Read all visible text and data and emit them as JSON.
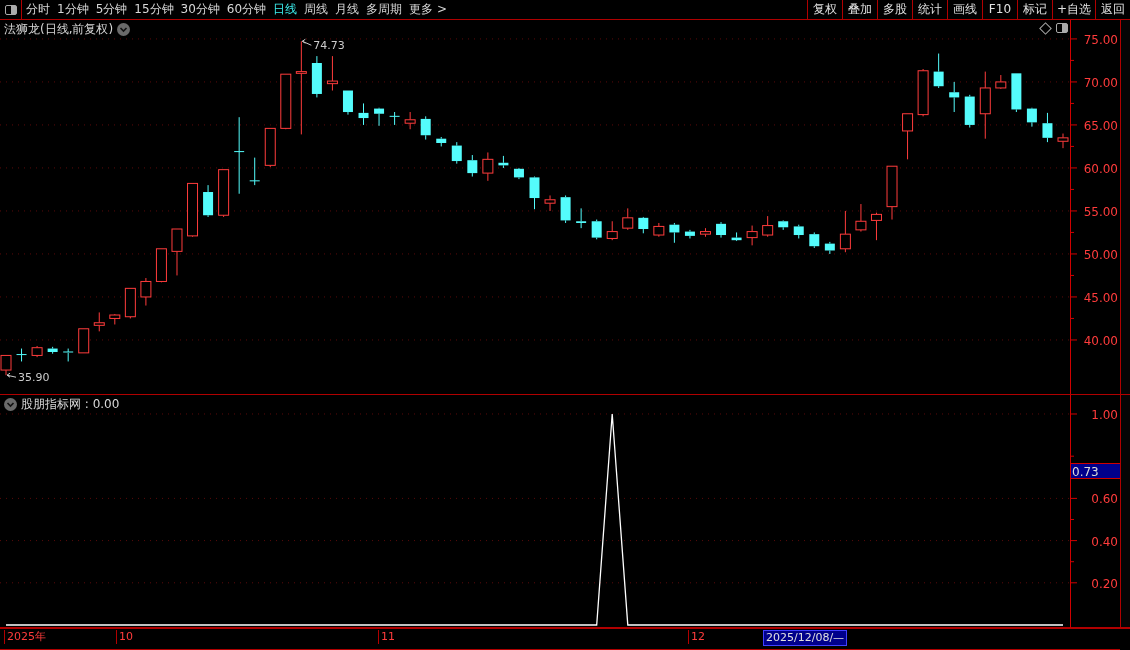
{
  "toolbar": {
    "periods": [
      {
        "label": "分时",
        "selected": false
      },
      {
        "label": "1分钟",
        "selected": false
      },
      {
        "label": "5分钟",
        "selected": false
      },
      {
        "label": "15分钟",
        "selected": false
      },
      {
        "label": "30分钟",
        "selected": false
      },
      {
        "label": "60分钟",
        "selected": false
      },
      {
        "label": "日线",
        "selected": true
      },
      {
        "label": "周线",
        "selected": false
      },
      {
        "label": "月线",
        "selected": false
      },
      {
        "label": "多周期",
        "selected": false
      },
      {
        "label": "更多 >",
        "selected": false
      }
    ],
    "buttons": [
      "复权",
      "叠加",
      "多股",
      "统计",
      "画线",
      "F10",
      "标记",
      "+自选",
      "返回"
    ]
  },
  "price_panel": {
    "title": "法狮龙(日线,前复权)",
    "high_label": "74.73",
    "low_label": "35.90",
    "chart_data": {
      "type": "candlestick",
      "ylim": [
        33.6,
        77.2
      ],
      "yticks": [
        {
          "value": 75,
          "label": "75.00"
        },
        {
          "value": 70,
          "label": "70.00"
        },
        {
          "value": 65,
          "label": "65.00"
        },
        {
          "value": 60,
          "label": "60.00"
        },
        {
          "value": 55,
          "label": "55.00"
        },
        {
          "value": 50,
          "label": "50.00"
        },
        {
          "value": 45,
          "label": "45.00"
        },
        {
          "value": 40,
          "label": "40.00"
        }
      ],
      "grid": true,
      "ohlc": [
        [
          36.5,
          38.2,
          35.9,
          38.2
        ],
        [
          38.3,
          39.0,
          37.5,
          38.3
        ],
        [
          38.2,
          39.3,
          38.0,
          39.1
        ],
        [
          39.0,
          39.2,
          38.4,
          38.6
        ],
        [
          38.6,
          39.0,
          37.5,
          38.5
        ],
        [
          38.5,
          41.3,
          38.5,
          41.3
        ],
        [
          41.7,
          43.2,
          41.0,
          42.0
        ],
        [
          42.5,
          43.0,
          41.8,
          42.9
        ],
        [
          42.7,
          46.0,
          42.5,
          46.0
        ],
        [
          45.0,
          47.2,
          44.0,
          46.8
        ],
        [
          46.8,
          50.6,
          46.7,
          50.6
        ],
        [
          50.3,
          52.9,
          47.5,
          52.9
        ],
        [
          52.1,
          58.2,
          52.0,
          58.2
        ],
        [
          57.2,
          58.0,
          54.3,
          54.5
        ],
        [
          54.5,
          59.8,
          54.3,
          59.8
        ],
        [
          61.9,
          65.9,
          57.0,
          61.9
        ],
        [
          58.5,
          61.2,
          58.0,
          58.5
        ],
        [
          60.3,
          64.6,
          60.1,
          64.6
        ],
        [
          64.6,
          70.9,
          64.5,
          70.9
        ],
        [
          71.0,
          74.73,
          63.9,
          71.2
        ],
        [
          72.2,
          73.0,
          68.2,
          68.6
        ],
        [
          69.8,
          73.0,
          69.0,
          70.1
        ],
        [
          69.0,
          69.0,
          66.2,
          66.5
        ],
        [
          66.4,
          67.5,
          65.0,
          65.8
        ],
        [
          66.9,
          67.0,
          64.9,
          66.3
        ],
        [
          66.0,
          66.5,
          65.0,
          66.0
        ],
        [
          65.2,
          66.5,
          64.5,
          65.6
        ],
        [
          65.7,
          66.0,
          63.3,
          63.8
        ],
        [
          63.4,
          63.6,
          62.5,
          62.9
        ],
        [
          62.6,
          63.0,
          60.5,
          60.8
        ],
        [
          60.9,
          61.5,
          59.0,
          59.4
        ],
        [
          59.4,
          61.8,
          58.5,
          61.0
        ],
        [
          60.6,
          61.4,
          60.0,
          60.3
        ],
        [
          59.9,
          60.0,
          58.7,
          58.9
        ],
        [
          58.9,
          59.0,
          55.2,
          56.5
        ],
        [
          55.9,
          56.8,
          55.0,
          56.3
        ],
        [
          56.6,
          56.8,
          53.6,
          53.9
        ],
        [
          53.8,
          55.3,
          53.0,
          53.6
        ],
        [
          53.8,
          54.0,
          51.7,
          51.9
        ],
        [
          51.8,
          53.8,
          51.6,
          52.6
        ],
        [
          53.0,
          55.3,
          52.8,
          54.2
        ],
        [
          54.2,
          54.3,
          52.4,
          52.9
        ],
        [
          52.2,
          53.6,
          52.0,
          53.2
        ],
        [
          53.4,
          53.6,
          51.3,
          52.5
        ],
        [
          52.6,
          52.8,
          51.8,
          52.1
        ],
        [
          52.3,
          53.0,
          52.0,
          52.6
        ],
        [
          53.5,
          53.7,
          51.9,
          52.2
        ],
        [
          51.9,
          52.5,
          51.5,
          51.6
        ],
        [
          51.9,
          53.3,
          51.0,
          52.6
        ],
        [
          52.2,
          54.4,
          52.0,
          53.3
        ],
        [
          53.8,
          53.9,
          52.8,
          53.1
        ],
        [
          53.2,
          53.4,
          51.8,
          52.2
        ],
        [
          52.3,
          52.5,
          50.7,
          50.9
        ],
        [
          51.2,
          51.4,
          50.0,
          50.4
        ],
        [
          50.6,
          55.0,
          50.2,
          52.3
        ],
        [
          52.8,
          55.8,
          52.6,
          53.8
        ],
        [
          53.9,
          54.8,
          51.6,
          54.6
        ],
        [
          55.5,
          60.2,
          54.0,
          60.2
        ],
        [
          64.3,
          66.3,
          61.0,
          66.3
        ],
        [
          66.2,
          71.5,
          66.0,
          71.3
        ],
        [
          71.2,
          73.3,
          69.3,
          69.5
        ],
        [
          68.8,
          70.0,
          66.5,
          68.2
        ],
        [
          68.3,
          68.5,
          64.7,
          65.0
        ],
        [
          66.3,
          71.2,
          63.4,
          69.3
        ],
        [
          69.3,
          70.8,
          69.2,
          70.0
        ],
        [
          71.0,
          71.0,
          66.5,
          66.8
        ],
        [
          66.9,
          67.0,
          64.8,
          65.3
        ],
        [
          65.2,
          66.4,
          63.0,
          63.5
        ],
        [
          63.1,
          64.0,
          62.3,
          63.5
        ]
      ]
    }
  },
  "indicator_panel": {
    "title": "股朋指标网 : 0.00",
    "cursor_value": "0.73",
    "chart_data": {
      "type": "line",
      "ylim": [
        0,
        1.09
      ],
      "grid": true,
      "yticks": [
        {
          "value": 1,
          "label": "1.00"
        },
        {
          "value": 0.6,
          "label": "0.60"
        },
        {
          "value": 0.4,
          "label": "0.40"
        },
        {
          "value": 0.2,
          "label": "0.20"
        }
      ],
      "series": [
        {
          "color": "#ffffff",
          "values": [
            0,
            0,
            0,
            0,
            0,
            0,
            0,
            0,
            0,
            0,
            0,
            0,
            0,
            0,
            0,
            0,
            0,
            0,
            0,
            0,
            0,
            0,
            0,
            0,
            0,
            0,
            0,
            0,
            0,
            0,
            0,
            0,
            0,
            0,
            0,
            0,
            0,
            0,
            0,
            1,
            0,
            0,
            0,
            0,
            0,
            0,
            0,
            0,
            0,
            0,
            0,
            0,
            0,
            0,
            0,
            0,
            0,
            0,
            0,
            0,
            0,
            0,
            0,
            0,
            0,
            0,
            0,
            0,
            0
          ]
        }
      ]
    }
  },
  "time_axis": {
    "labels": [
      {
        "label": "2025年",
        "selected": false
      },
      {
        "label": "10",
        "selected": false
      },
      {
        "label": "11",
        "selected": false
      },
      {
        "label": "12",
        "selected": false
      },
      {
        "label": "2025/12/08/—",
        "selected": true
      }
    ]
  }
}
